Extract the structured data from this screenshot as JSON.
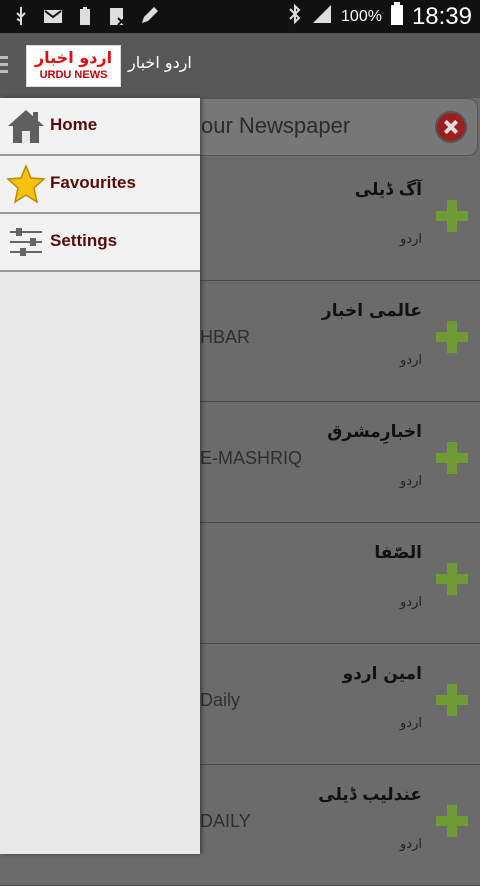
{
  "status_bar": {
    "battery_percent": "100%",
    "time": "18:39"
  },
  "app_bar": {
    "logo_urdu": "اردو اخبار",
    "logo_english": "URDU NEWS",
    "title": "اردو اخبار"
  },
  "search": {
    "placeholder_visible": "our Newspaper"
  },
  "newspapers": [
    {
      "urdu": "آگ ڈیلی",
      "english": "",
      "lang": "اردو"
    },
    {
      "urdu": "عالمی اخبار",
      "english": "HBAR",
      "lang": "اردو"
    },
    {
      "urdu": "اخبارِمشرق",
      "english": "E-MASHRIQ",
      "lang": "اردو"
    },
    {
      "urdu": "الصّفا",
      "english": "",
      "lang": "اردو"
    },
    {
      "urdu": "امین اردو",
      "english": "Daily",
      "lang": "اردو"
    },
    {
      "urdu": "عندلیب ڈیلی",
      "english": "DAILY",
      "lang": "اردو"
    }
  ],
  "drawer": {
    "items": [
      {
        "label": "Home",
        "icon": "home-icon"
      },
      {
        "label": "Favourites",
        "icon": "star-icon"
      },
      {
        "label": "Settings",
        "icon": "sliders-icon"
      }
    ]
  },
  "colors": {
    "logo_red": "#d11111",
    "drawer_label": "#5a0b0b",
    "plus_green": "#7fb33a"
  }
}
